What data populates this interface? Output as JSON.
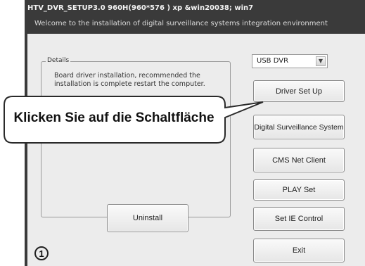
{
  "window": {
    "title": "HTV_DVR_SETUP3.0  960H(960*576 ) xp &win20038; win7",
    "welcome": "Welcome to the installation of digital surveillance systems integration environment"
  },
  "details": {
    "legend": "Details",
    "text": "Board driver installation, recommended the installation is complete restart the computer."
  },
  "dvr_select": {
    "value": "USB DVR"
  },
  "buttons": {
    "driver_setup": "Driver Set Up",
    "digital_surveillance": "Digital Surveillance System",
    "cms_net_client": "CMS Net Client",
    "play_set": "PLAY Set",
    "set_ie_control": "Set IE Control",
    "exit": "Exit",
    "uninstall": "Uninstall"
  },
  "callout": {
    "text": "Klicken Sie auf die Schaltfläche"
  },
  "step_number": "1"
}
